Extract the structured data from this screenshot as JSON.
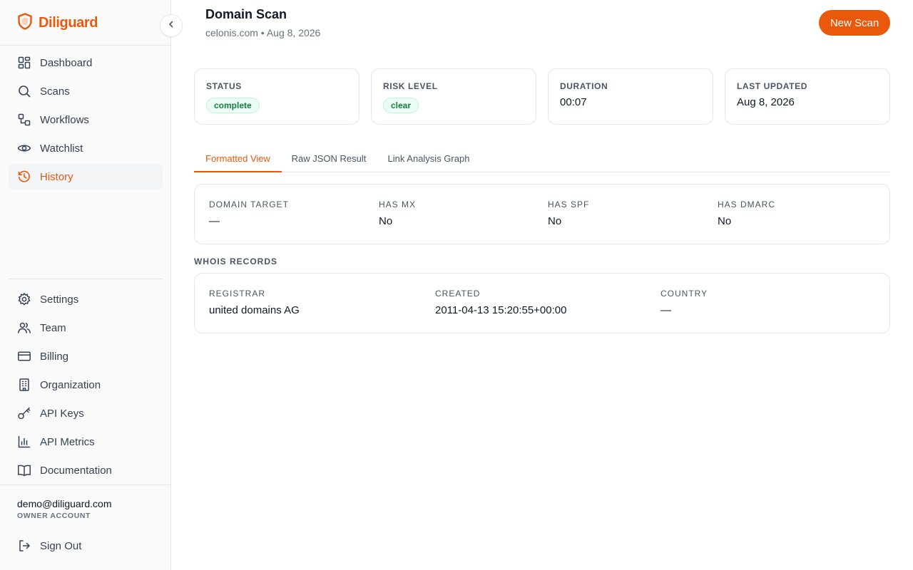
{
  "brand": {
    "name": "Diliguard",
    "accent": "#ea580c"
  },
  "sidebar": {
    "collapse_icon": "chevron-left-icon",
    "main_items": [
      {
        "label": "Dashboard",
        "icon": "dashboard-icon",
        "active": false
      },
      {
        "label": "Scans",
        "icon": "search-icon",
        "active": false
      },
      {
        "label": "Workflows",
        "icon": "workflow-icon",
        "active": false
      },
      {
        "label": "Watchlist",
        "icon": "eye-icon",
        "active": false
      },
      {
        "label": "History",
        "icon": "history-icon",
        "active": true
      }
    ],
    "bottom_items": [
      {
        "label": "Settings",
        "icon": "gear-icon"
      },
      {
        "label": "Team",
        "icon": "users-icon"
      },
      {
        "label": "Billing",
        "icon": "credit-card-icon"
      },
      {
        "label": "Organization",
        "icon": "building-icon"
      },
      {
        "label": "API Keys",
        "icon": "key-icon"
      },
      {
        "label": "API Metrics",
        "icon": "bar-chart-icon"
      },
      {
        "label": "Documentation",
        "icon": "book-icon"
      }
    ],
    "user": {
      "email": "demo@diliguard.com",
      "role": "OWNER ACCOUNT"
    },
    "sign_out": {
      "label": "Sign Out",
      "icon": "sign-out-icon"
    }
  },
  "header": {
    "title": "Domain Scan",
    "subtitle": "celonis.com • Aug 8, 2026",
    "new_scan_label": "New Scan"
  },
  "stats": [
    {
      "label": "STATUS",
      "value": "complete",
      "type": "badge"
    },
    {
      "label": "RISK LEVEL",
      "value": "clear",
      "type": "badge"
    },
    {
      "label": "DURATION",
      "value": "00:07",
      "type": "text"
    },
    {
      "label": "LAST UPDATED",
      "value": "Aug 8, 2026",
      "type": "text"
    }
  ],
  "tabs": [
    {
      "label": "Formatted View",
      "active": true
    },
    {
      "label": "Raw JSON Result",
      "active": false
    },
    {
      "label": "Link Analysis Graph",
      "active": false
    }
  ],
  "domain_info": [
    {
      "label": "DOMAIN TARGET",
      "value": "—"
    },
    {
      "label": "HAS MX",
      "value": "No"
    },
    {
      "label": "HAS SPF",
      "value": "No"
    },
    {
      "label": "HAS DMARC",
      "value": "No"
    }
  ],
  "whois": {
    "heading": "WHOIS RECORDS",
    "fields": [
      {
        "label": "REGISTRAR",
        "value": "united domains AG"
      },
      {
        "label": "CREATED",
        "value": "2011-04-13 15:20:55+00:00"
      },
      {
        "label": "COUNTRY",
        "value": "—"
      }
    ]
  }
}
